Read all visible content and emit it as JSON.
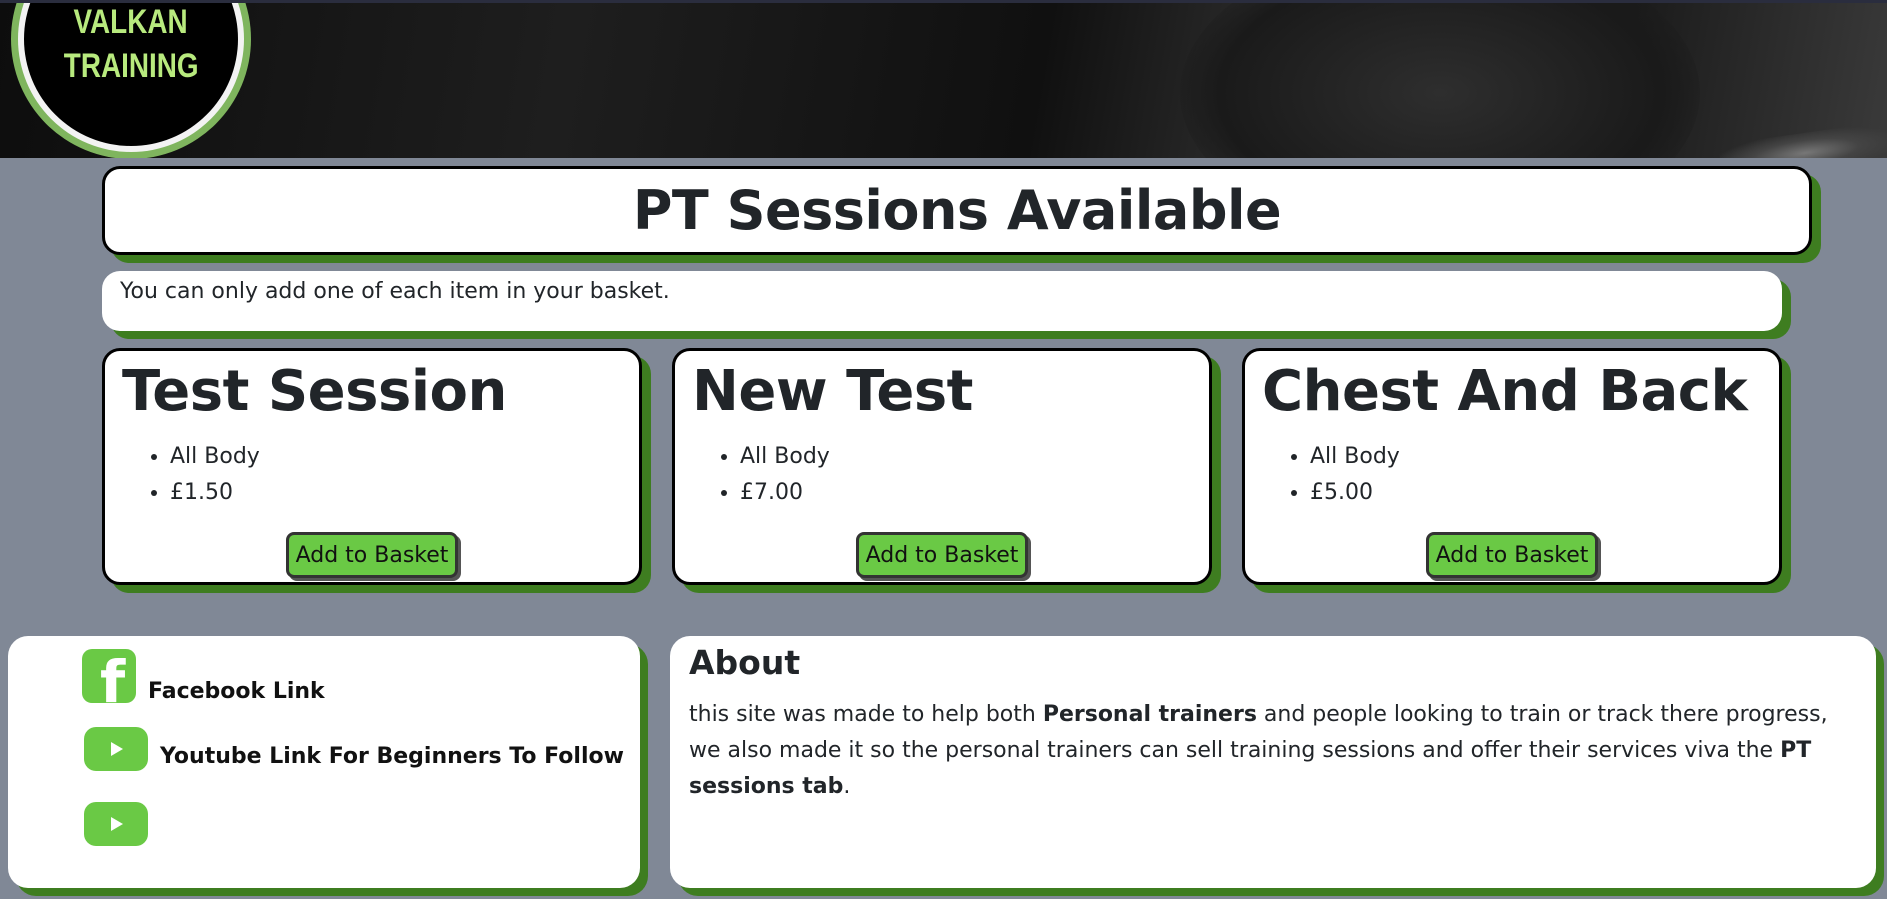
{
  "header": {
    "logo_line1": "VALKAN",
    "logo_line2": "TRAINING"
  },
  "page": {
    "title": "PT Sessions Available",
    "notice": "You can only add one of each item in your basket."
  },
  "sessions": [
    {
      "name": "Test Session",
      "focus": "All Body",
      "price": "£1.50",
      "button": "Add to Basket"
    },
    {
      "name": "New Test",
      "focus": "All Body",
      "price": "£7.00",
      "button": "Add to Basket"
    },
    {
      "name": "Chest And Back",
      "focus": "All Body",
      "price": "£5.00",
      "button": "Add to Basket"
    }
  ],
  "links": {
    "facebook_label": "Facebook Link",
    "youtube_label": "Youtube Link For Beginners To Follow",
    "icons": [
      "facebook-icon",
      "youtube-icon",
      "youtube-icon"
    ]
  },
  "about": {
    "heading": "About",
    "text_1": "this site was made to help both ",
    "bold_1": "Personal trainers",
    "text_2": " and people looking to train or track there progress, we also made it so the personal trainers can sell training sessions and offer their services viva the ",
    "bold_2": "PT sessions tab",
    "text_3": "."
  },
  "colors": {
    "page_background": "#808896",
    "accent_green": "#6ac945",
    "shadow_green": "#3e7d20",
    "logo_text": "#b8ea7e"
  }
}
